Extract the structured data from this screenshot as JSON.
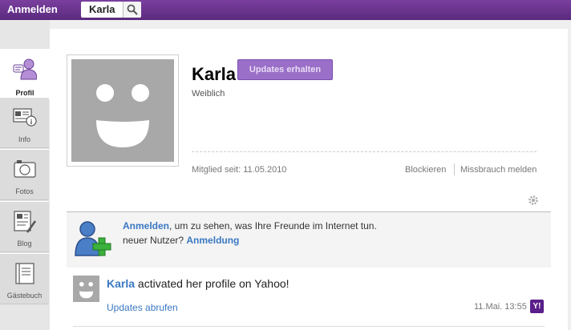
{
  "topbar": {
    "signin_label": "Anmelden",
    "search_value": "Karla",
    "search_icon": "search-icon"
  },
  "sidebar": {
    "items": [
      {
        "label": "Profil",
        "icon": "profile-icon",
        "active": true
      },
      {
        "label": "Info",
        "icon": "info-icon",
        "active": false
      },
      {
        "label": "Fotos",
        "icon": "camera-icon",
        "active": false
      },
      {
        "label": "Blog",
        "icon": "blog-icon",
        "active": false
      },
      {
        "label": "Gästebuch",
        "icon": "guestbook-icon",
        "active": false
      }
    ]
  },
  "profile": {
    "name": "Karla",
    "follow_label": "Updates erhalten",
    "gender": "Weiblich",
    "member_since": "Mitglied seit: 11.05.2010",
    "block_label": "Blockieren",
    "report_label": "Missbrauch melden"
  },
  "signup": {
    "signin_link": "Anmelden",
    "line1_rest": ", um zu sehen, was Ihre Freunde im Internet tun.",
    "line2_prefix": "neuer Nutzer? ",
    "register_link": "Anmeldung"
  },
  "activity": {
    "name": "Karla",
    "text": " activated her profile on Yahoo!",
    "more_label": "Updates abrufen",
    "timestamp": "11.Mai. 13:55",
    "badge": "Y!"
  },
  "colors": {
    "brand_purple": "#5a2a7e",
    "button_purple": "#9a6fc8",
    "link_blue": "#3a78c3"
  }
}
